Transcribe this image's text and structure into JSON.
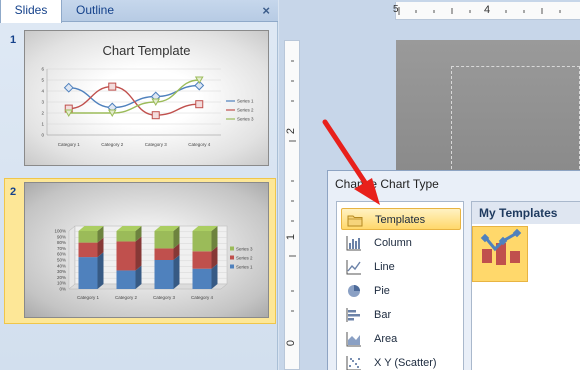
{
  "pane": {
    "tabs": [
      "Slides",
      "Outline"
    ],
    "close_glyph": "×",
    "slides": [
      {
        "number": "1",
        "title": "Chart Template"
      },
      {
        "number": "2",
        "title": ""
      }
    ]
  },
  "slide1_chart": {
    "type": "line",
    "categories": [
      "Category 1",
      "Category 2",
      "Category 3",
      "Category 4"
    ],
    "ylim": [
      0,
      6
    ],
    "yticks": [
      "0",
      "1",
      "2",
      "3",
      "4",
      "5",
      "6"
    ],
    "series": [
      {
        "name": "Series 1",
        "color": "#4f81bd",
        "values": [
          4.3,
          2.5,
          3.5,
          4.5
        ]
      },
      {
        "name": "Series 2",
        "color": "#c0504d",
        "values": [
          2.4,
          4.4,
          1.8,
          2.8
        ]
      },
      {
        "name": "Series 3",
        "color": "#9bbb59",
        "values": [
          2.0,
          2.0,
          3.0,
          5.0
        ]
      }
    ]
  },
  "slide2_chart": {
    "type": "bar",
    "categories": [
      "Category 1",
      "Category 2",
      "Category 3",
      "Category 4"
    ],
    "yticks": [
      "0%",
      "10%",
      "20%",
      "30%",
      "40%",
      "50%",
      "60%",
      "70%",
      "80%",
      "90%",
      "100%"
    ],
    "series": [
      {
        "name": "Series 1",
        "color": "#4f81bd",
        "values": [
          0.55,
          0.32,
          0.5,
          0.35
        ]
      },
      {
        "name": "Series 2",
        "color": "#c0504d",
        "values": [
          0.25,
          0.5,
          0.2,
          0.3
        ]
      },
      {
        "name": "Series 3",
        "color": "#9bbb59",
        "values": [
          0.2,
          0.18,
          0.3,
          0.35
        ]
      }
    ],
    "legend_order": [
      "Series 3",
      "Series 2",
      "Series 1"
    ]
  },
  "rulers": {
    "horizontal": [
      "5",
      "4"
    ],
    "vertical": [
      "2",
      "1",
      "0"
    ]
  },
  "dialog": {
    "title": "Change Chart Type",
    "chart_types": [
      {
        "label": "Templates",
        "icon": "folder-icon",
        "selected": true
      },
      {
        "label": "Column",
        "icon": "column-chart-icon"
      },
      {
        "label": "Line",
        "icon": "line-chart-icon"
      },
      {
        "label": "Pie",
        "icon": "pie-chart-icon"
      },
      {
        "label": "Bar",
        "icon": "bar-chart-icon"
      },
      {
        "label": "Area",
        "icon": "area-chart-icon"
      },
      {
        "label": "X Y (Scatter)",
        "icon": "scatter-chart-icon"
      }
    ],
    "my_templates_heading": "My Templates"
  },
  "colors": {
    "accent_selection": "#ffd86b",
    "arrow": "#e8201b"
  }
}
